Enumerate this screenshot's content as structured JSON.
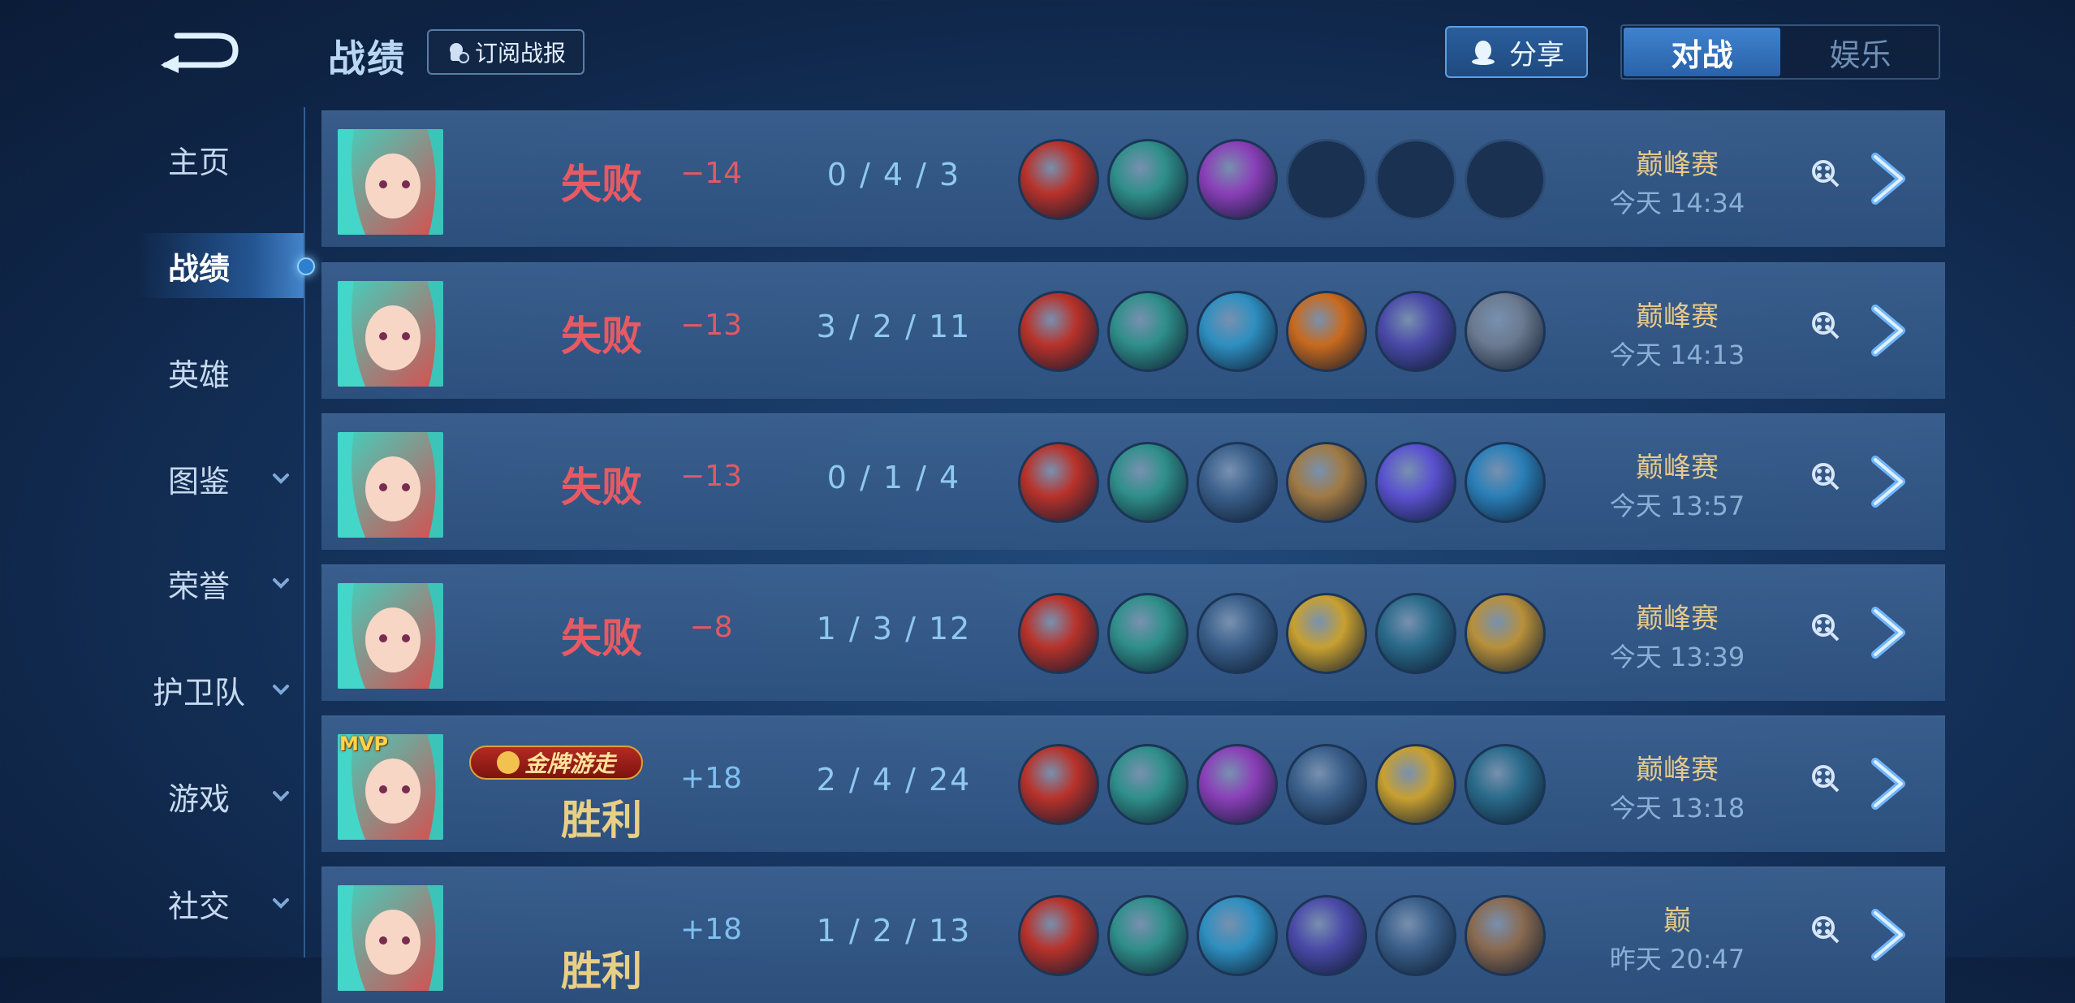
{
  "header": {
    "title": "战绩",
    "subscribe_label": "订阅战报",
    "share_label": "分享",
    "mode_tabs": [
      {
        "label": "对战",
        "active": true
      },
      {
        "label": "娱乐",
        "active": false
      }
    ]
  },
  "sidebar": {
    "items": [
      {
        "label": "主页",
        "expandable": false,
        "active": false
      },
      {
        "label": "战绩",
        "expandable": false,
        "active": true
      },
      {
        "label": "英雄",
        "expandable": false,
        "active": false
      },
      {
        "label": "图鉴",
        "expandable": true,
        "active": false
      },
      {
        "label": "荣誉",
        "expandable": true,
        "active": false
      },
      {
        "label": "护卫队",
        "expandable": true,
        "active": false
      },
      {
        "label": "游戏",
        "expandable": true,
        "active": false
      },
      {
        "label": "社交",
        "expandable": true,
        "active": false
      }
    ]
  },
  "matches": [
    {
      "result": "失败",
      "win": false,
      "score": "−14",
      "kda": "0 / 4 / 3",
      "mode": "巅峰赛",
      "time": "今天 14:34",
      "mvp": false,
      "badge": "",
      "items": [
        "#b8322a",
        "#2f8f8a",
        "#8a3fb8",
        "",
        "",
        ""
      ]
    },
    {
      "result": "失败",
      "win": false,
      "score": "−13",
      "kda": "3 / 2 / 11",
      "mode": "巅峰赛",
      "time": "今天 14:13",
      "mvp": false,
      "badge": "",
      "items": [
        "#b8322a",
        "#2f8f8a",
        "#2e8fc0",
        "#c86a1e",
        "#4a4aa8",
        "#6b7a90"
      ]
    },
    {
      "result": "失败",
      "win": false,
      "score": "−13",
      "kda": "0 / 1 / 4",
      "mode": "巅峰赛",
      "time": "今天 13:57",
      "mvp": false,
      "badge": "",
      "items": [
        "#b8322a",
        "#2f8f8a",
        "#3a5f8a",
        "#a07a44",
        "#5a52d0",
        "#2a7fb8"
      ]
    },
    {
      "result": "失败",
      "win": false,
      "score": "−8",
      "kda": "1 / 3 / 12",
      "mode": "巅峰赛",
      "time": "今天 13:39",
      "mvp": false,
      "badge": "",
      "items": [
        "#b8322a",
        "#2f8f8a",
        "#3a5f8a",
        "#c8a030",
        "#2a6a8a",
        "#b8903a"
      ]
    },
    {
      "result": "胜利",
      "win": true,
      "score": "+18",
      "kda": "2 / 4 / 24",
      "mode": "巅峰赛",
      "time": "今天 13:18",
      "mvp": true,
      "badge": "金牌游走",
      "items": [
        "#b8322a",
        "#2f8f8a",
        "#8a3fb8",
        "#3a5f8a",
        "#c8a030",
        "#2a6a8a"
      ]
    },
    {
      "result": "胜利",
      "win": true,
      "score": "+18",
      "kda": "1 / 2 / 13",
      "mode": "巅",
      "time": "昨天 20:47",
      "mvp": false,
      "badge": "",
      "items": [
        "#b8322a",
        "#2f8f8a",
        "#2e8fc0",
        "#4a4aa8",
        "#3a5f8a",
        "#8a6a50"
      ]
    }
  ],
  "colors": {
    "lose": "#e85a63",
    "win": "#e8cf86",
    "accent": "#3f82cf"
  }
}
